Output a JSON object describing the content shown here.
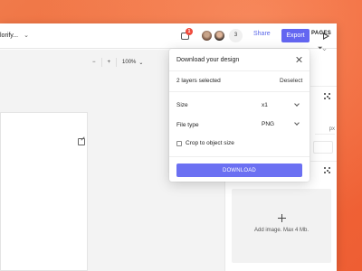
{
  "header": {
    "file_name": "lorify...",
    "notification_count": "1",
    "collaborator_count": "3",
    "share_label": "Share",
    "export_label": "Export"
  },
  "canvas": {
    "zoom_minus": "−",
    "zoom_plus": "+",
    "zoom_value": "100%"
  },
  "right_panel": {
    "pages_label": "PAGES",
    "unit_label": "px",
    "image_drop_text": "Add image. Max 4 Mb."
  },
  "dialog": {
    "title": "Download your design",
    "selection_text": "2 layers selected",
    "deselect_label": "Deselect",
    "size_label": "Size",
    "size_value": "x1",
    "file_type_label": "File type",
    "file_type_value": "PNG",
    "crop_label": "Crop to object size",
    "crop_checked": false,
    "download_label": "DOWNLOAD"
  },
  "colors": {
    "background": "#f36b3c",
    "accent": "#6366f1",
    "badge": "#ef4a3c"
  }
}
